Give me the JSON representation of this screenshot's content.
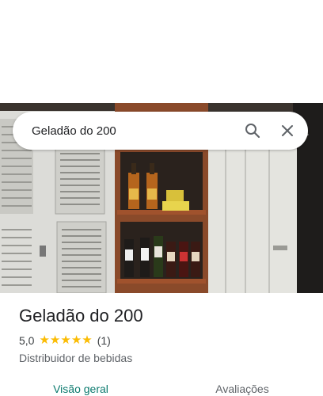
{
  "search": {
    "query": "Geladão do 200"
  },
  "place": {
    "name": "Geladão do 200",
    "rating": "5,0",
    "stars_filled": 5,
    "review_count": "(1)",
    "category": "Distribuidor de bebidas"
  },
  "tabs": [
    {
      "label": "Visão geral",
      "active": true
    },
    {
      "label": "Avaliações",
      "active": false
    }
  ],
  "colors": {
    "accent": "#0b7a6e",
    "star": "#fbbc04"
  },
  "icons": {
    "search": "search-icon",
    "close": "close-icon",
    "star": "star-icon"
  }
}
